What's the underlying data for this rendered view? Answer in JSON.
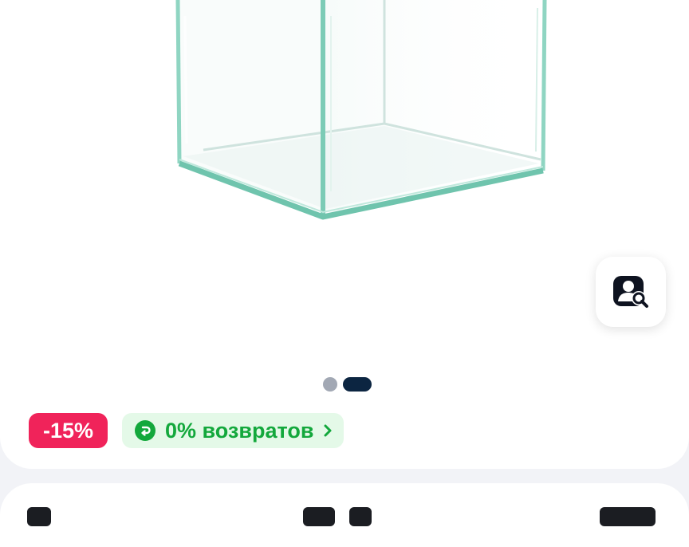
{
  "product": {
    "image_alt": "glass-aquarium",
    "visual_search_icon": "visual-search-icon",
    "carousel": {
      "total": 2,
      "active_index": 1
    }
  },
  "badges": {
    "discount": "-15%",
    "returns": "0% возвратов",
    "returns_icon": "return-arrow-icon",
    "chevron_icon": "chevron-right-icon"
  },
  "colors": {
    "discount_bg": "#f0235a",
    "returns_bg": "#e4f9e8",
    "returns_text": "#13a83c",
    "dot_active": "#0c2541",
    "dot_inactive": "#a2a8b4",
    "page_bg": "#f2f3f7"
  }
}
